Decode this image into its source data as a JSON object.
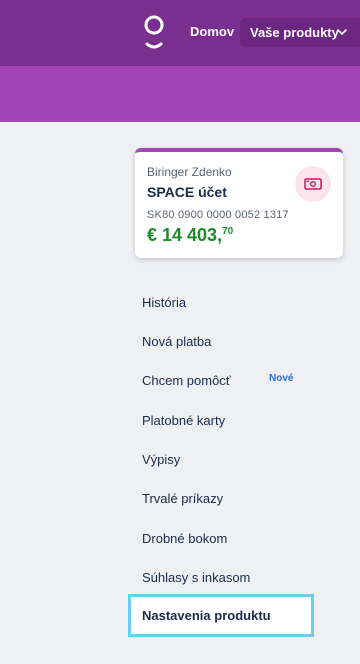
{
  "header": {
    "home_label": "Domov",
    "products_label": "Vaše produkty"
  },
  "account": {
    "owner": "Biringer Zdenko",
    "name": "SPACE účet",
    "iban": "SK80 0900 0000 0052 1317",
    "balance_main": "€ 14 403,",
    "balance_cents": "70",
    "balance_color": "#1e8a2c"
  },
  "menu": {
    "items": [
      {
        "label": "História"
      },
      {
        "label": "Nová platba"
      },
      {
        "label": "Chcem pomôcť",
        "badge": "Nové"
      },
      {
        "label": "Platobné karty"
      },
      {
        "label": "Výpisy"
      },
      {
        "label": "Trvalé príkazy"
      },
      {
        "label": "Drobné bokom"
      },
      {
        "label": "Súhlasy s inkasom"
      },
      {
        "label": "Nastavenia produktu",
        "selected": true
      }
    ]
  },
  "colors": {
    "topbar": "#7a2f8f",
    "band": "#a445b6",
    "selection_outline": "#6dcdec",
    "badge": "#2f6ad6"
  }
}
